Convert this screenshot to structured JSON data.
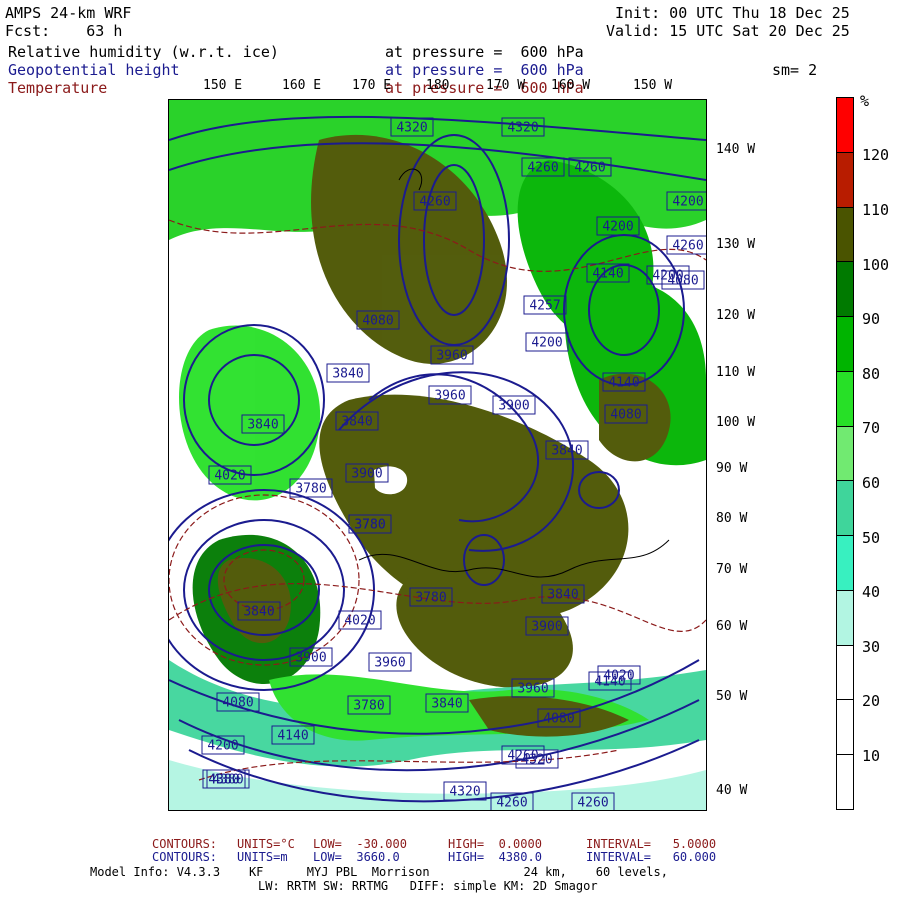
{
  "header": {
    "model": "AMPS 24-km WRF",
    "fcst": "Fcst:    63 h",
    "init": "Init: 00 UTC Thu 18 Dec 25",
    "valid": "Valid: 15 UTC Sat 20 Dec 25",
    "smoothing": "sm= 2"
  },
  "fields": [
    {
      "name": "Relative humidity (w.r.t. ice)",
      "level": "at pressure =  600 hPa",
      "color": "#000000"
    },
    {
      "name": "Geopotential height",
      "level": "at pressure =  600 hPa",
      "color": "#1b1b8f"
    },
    {
      "name": "Temperature",
      "level": "at pressure =  600 hPa",
      "color": "#8b1a1a"
    }
  ],
  "longitude_labels": [
    "150 E",
    "160 E",
    "170 E",
    "180",
    "170 W",
    "160 W",
    "150 W"
  ],
  "latitude_labels": [
    "140 W",
    "130 W",
    "120 W",
    "110 W",
    "100 W",
    "90 W",
    "80 W",
    "70 W",
    "60 W",
    "50 W",
    "40 W"
  ],
  "height_contour_labels": [
    "4320",
    "4320",
    "4260",
    "4260",
    "4260",
    "4200",
    "4200",
    "4260",
    "4200",
    "4140",
    "4080",
    "4257",
    "4200",
    "4080",
    "3960",
    "3840",
    "3960",
    "3900",
    "3840",
    "3840",
    "4080",
    "4140",
    "3900",
    "3840",
    "4020",
    "3780",
    "3780",
    "3780",
    "4020",
    "3960",
    "3900",
    "3840",
    "3840",
    "3900",
    "3780",
    "3780",
    "3840",
    "3960",
    "4020",
    "4080",
    "4140",
    "4080",
    "4140",
    "4200",
    "4260",
    "4320",
    "4380",
    "4320",
    "4260",
    "4260",
    "4380",
    "4380"
  ],
  "colorbar": {
    "unit": "%",
    "tick_labels": [
      "120",
      "110",
      "100",
      "90",
      "80",
      "70",
      "60",
      "50",
      "40",
      "30",
      "20",
      "10"
    ],
    "colors": [
      "#ff0000",
      "#b81c00",
      "#4a5400",
      "#007a00",
      "#00b400",
      "#27e027",
      "#71ea71",
      "#3fd59b",
      "#38f0c0",
      "#b2f5e2",
      "#ffffff",
      "#ffffff",
      "#ffffff"
    ]
  },
  "footer": {
    "temp_contours": {
      "label": "CONTOURS:",
      "units": "UNITS=°C",
      "low": "LOW=  -30.000",
      "high": "HIGH=  0.0000",
      "interval": "INTERVAL=   5.0000"
    },
    "height_contours": {
      "label": "CONTOURS:",
      "units": "UNITS=m",
      "low": "LOW=  3660.0",
      "high": "HIGH=  4380.0",
      "interval": "INTERVAL=   60.000"
    },
    "model_info_line1": "Model Info: V4.3.3    KF      MYJ PBL  Morrison             24 km,    60 levels,",
    "model_info_line2": "LW: RRTM SW: RRTMG   DIFF: simple KM: 2D Smagor"
  }
}
